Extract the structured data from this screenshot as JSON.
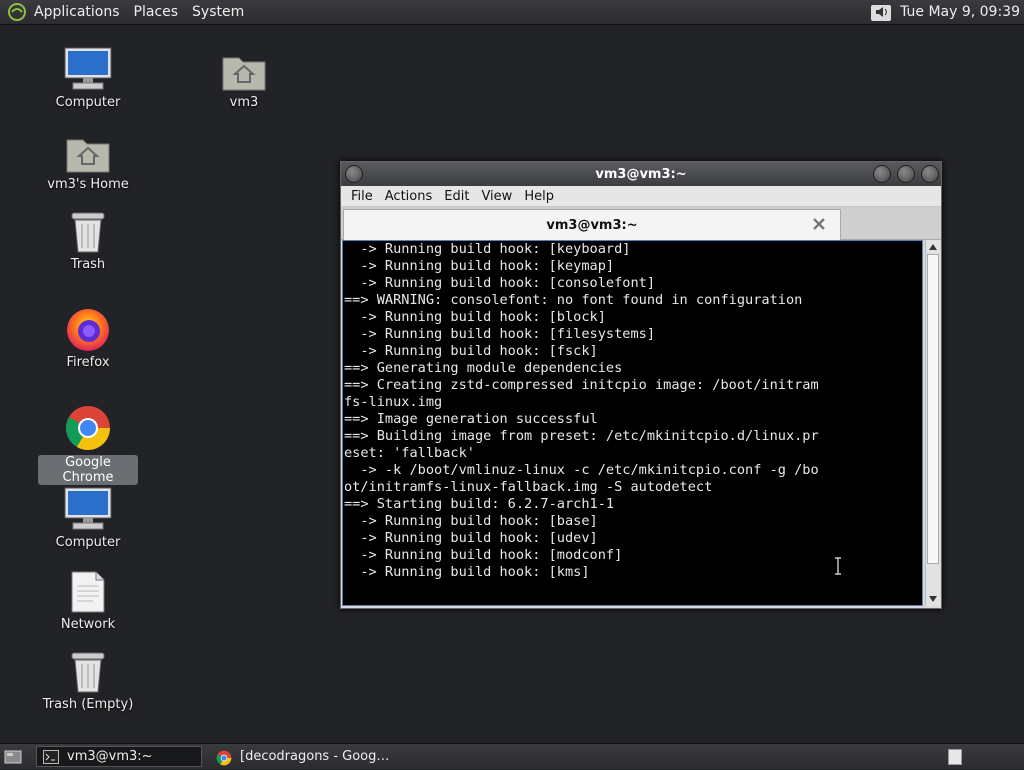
{
  "top_panel": {
    "menus": [
      "Applications",
      "Places",
      "System"
    ],
    "clock": "Tue May  9, 09:39"
  },
  "desktop_icons": [
    {
      "label": "Computer",
      "icon": "computer-icon"
    },
    {
      "label": "vm3's Home",
      "icon": "home-folder-icon"
    },
    {
      "label": "Trash",
      "icon": "trash-icon"
    },
    {
      "label": "Firefox",
      "icon": "firefox-icon"
    },
    {
      "label": "Google Chrome",
      "icon": "chrome-icon",
      "selected": true
    },
    {
      "label": "Computer",
      "icon": "computer-icon"
    },
    {
      "label": "Network",
      "icon": "document-icon"
    },
    {
      "label": "Trash (Empty)",
      "icon": "trash-icon"
    },
    {
      "label": "vm3",
      "icon": "home-folder-icon"
    }
  ],
  "terminal_window": {
    "title": "vm3@vm3:~",
    "menu": [
      "File",
      "Actions",
      "Edit",
      "View",
      "Help"
    ],
    "tab_title": "vm3@vm3:~",
    "output": "  -> Running build hook: [keyboard]\n  -> Running build hook: [keymap]\n  -> Running build hook: [consolefont]\n==> WARNING: consolefont: no font found in configuration\n  -> Running build hook: [block]\n  -> Running build hook: [filesystems]\n  -> Running build hook: [fsck]\n==> Generating module dependencies\n==> Creating zstd-compressed initcpio image: /boot/initram\nfs-linux.img\n==> Image generation successful\n==> Building image from preset: /etc/mkinitcpio.d/linux.pr\neset: 'fallback'\n  -> -k /boot/vmlinuz-linux -c /etc/mkinitcpio.conf -g /bo\not/initramfs-linux-fallback.img -S autodetect\n==> Starting build: 6.2.7-arch1-1\n  -> Running build hook: [base]\n  -> Running build hook: [udev]\n  -> Running build hook: [modconf]\n  -> Running build hook: [kms]"
  },
  "taskbar": {
    "tasks": [
      {
        "label": "vm3@vm3:~",
        "icon": "terminal-icon",
        "active": true
      },
      {
        "label": "[decodragons - Goog…",
        "icon": "chrome-icon",
        "active": false
      }
    ]
  },
  "colors": {
    "desktop_bg": "#222326",
    "terminal_bg": "#000000",
    "terminal_fg": "#e8e8e8",
    "selection": "#6b6e73"
  }
}
